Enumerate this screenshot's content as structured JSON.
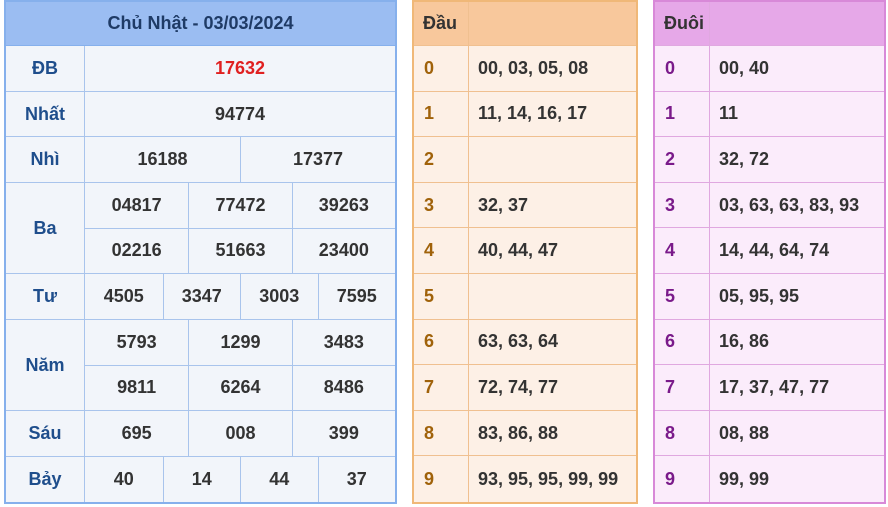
{
  "results": {
    "title": "Chủ Nhật - 03/03/2024",
    "prizes": [
      {
        "label": "ĐB",
        "lines": [
          [
            "17632"
          ]
        ]
      },
      {
        "label": "Nhất",
        "lines": [
          [
            "94774"
          ]
        ]
      },
      {
        "label": "Nhì",
        "lines": [
          [
            "16188",
            "17377"
          ]
        ]
      },
      {
        "label": "Ba",
        "lines": [
          [
            "04817",
            "77472",
            "39263"
          ],
          [
            "02216",
            "51663",
            "23400"
          ]
        ]
      },
      {
        "label": "Tư",
        "lines": [
          [
            "4505",
            "3347",
            "3003",
            "7595"
          ]
        ]
      },
      {
        "label": "Năm",
        "lines": [
          [
            "5793",
            "1299",
            "3483"
          ],
          [
            "9811",
            "6264",
            "8486"
          ]
        ]
      },
      {
        "label": "Sáu",
        "lines": [
          [
            "695",
            "008",
            "399"
          ]
        ]
      },
      {
        "label": "Bảy",
        "lines": [
          [
            "40",
            "14",
            "44",
            "37"
          ]
        ]
      }
    ]
  },
  "dau": {
    "header": "Đầu",
    "rows": [
      {
        "key": "0",
        "value": "00, 03, 05, 08"
      },
      {
        "key": "1",
        "value": "11, 14, 16, 17"
      },
      {
        "key": "2",
        "value": ""
      },
      {
        "key": "3",
        "value": "32, 37"
      },
      {
        "key": "4",
        "value": "40, 44, 47"
      },
      {
        "key": "5",
        "value": ""
      },
      {
        "key": "6",
        "value": "63, 63, 64"
      },
      {
        "key": "7",
        "value": "72, 74, 77"
      },
      {
        "key": "8",
        "value": "83, 86, 88"
      },
      {
        "key": "9",
        "value": "93, 95, 95, 99, 99"
      }
    ]
  },
  "duoi": {
    "header": "Đuôi",
    "rows": [
      {
        "key": "0",
        "value": "00, 40"
      },
      {
        "key": "1",
        "value": "11"
      },
      {
        "key": "2",
        "value": "32, 72"
      },
      {
        "key": "3",
        "value": "03, 63, 63, 83, 93"
      },
      {
        "key": "4",
        "value": "14, 44, 64, 74"
      },
      {
        "key": "5",
        "value": "05, 95, 95"
      },
      {
        "key": "6",
        "value": "16, 86"
      },
      {
        "key": "7",
        "value": "17, 37, 47, 77"
      },
      {
        "key": "8",
        "value": "08, 88"
      },
      {
        "key": "9",
        "value": "99, 99"
      }
    ]
  }
}
